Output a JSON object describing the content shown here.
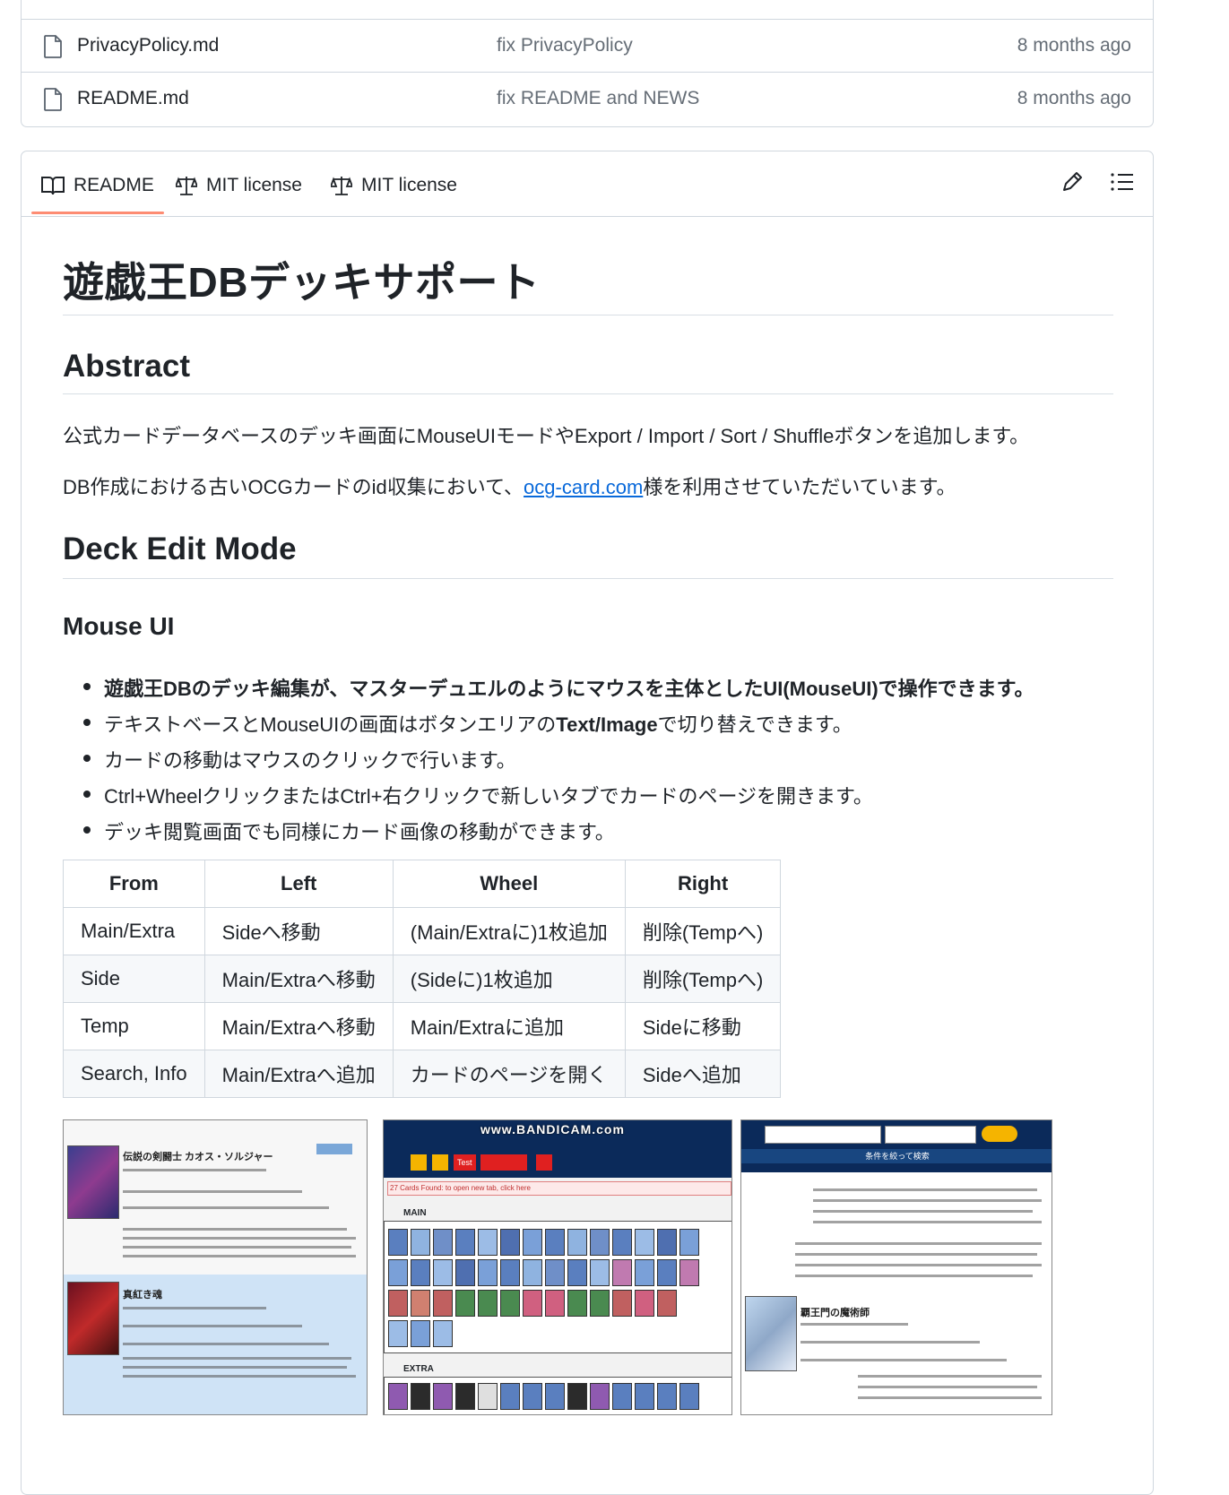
{
  "files": [
    {
      "name": "PrivacyPolicy.md",
      "message": "fix PrivacyPolicy",
      "age": "8 months ago"
    },
    {
      "name": "README.md",
      "message": "fix README and NEWS",
      "age": "8 months ago"
    }
  ],
  "tabs": [
    {
      "label": "README",
      "icon": "book-icon",
      "active": true
    },
    {
      "label": "MIT license",
      "icon": "scale-icon",
      "active": false
    },
    {
      "label": "MIT license",
      "icon": "scale-icon",
      "active": false
    }
  ],
  "toolbar": {
    "edit_icon": "pencil-icon",
    "outline_icon": "list-icon"
  },
  "readme": {
    "title": "遊戯王DBデッキサポート",
    "abstract_heading": "Abstract",
    "abstract_p1": "公式カードデータベースのデッキ画面にMouseUIモードやExport / Import / Sort / Shuffleボタンを追加します。",
    "abstract_p2_before": "DB作成における古いOCGカードのid収集において、",
    "abstract_p2_link": "ocg-card.com",
    "abstract_p2_after": "様を利用させていただいています。",
    "deck_edit_heading": "Deck Edit Mode",
    "mouse_ui_heading": "Mouse UI",
    "bullets": [
      {
        "bold": "遊戯王DBのデッキ編集が、マスターデュエルのようにマウスを主体としたUI(MouseUI)で操作できます。"
      },
      {
        "pre": "テキストベースとMouseUIの画面はボタンエリアの",
        "bold": "Text/Image",
        "post": "で切り替えできます。"
      },
      {
        "pre": "カードの移動はマウスのクリックで行います。"
      },
      {
        "pre": "Ctrl+WheelクリックまたはCtrl+右クリックで新しいタブでカードのページを開きます。"
      },
      {
        "pre": "デッキ閲覧画面でも同様にカード画像の移動ができます。"
      }
    ],
    "table": {
      "headers": [
        "From",
        "Left",
        "Wheel",
        "Right"
      ],
      "rows": [
        [
          "Main/Extra",
          "Sideへ移動",
          "(Main/Extraに)1枚追加",
          "削除(Tempへ)"
        ],
        [
          "Side",
          "Main/Extraへ移動",
          "(Sideに)1枚追加",
          "削除(Tempへ)"
        ],
        [
          "Temp",
          "Main/Extraへ移動",
          "Main/Extraに追加",
          "Sideに移動"
        ],
        [
          "Search, Info",
          "Main/Extraへ追加",
          "カードのページを開く",
          "Sideへ追加"
        ]
      ]
    },
    "screenshots": {
      "watermark": "www.BANDICAM.com",
      "middle_main": "MAIN",
      "middle_extra": "EXTRA",
      "middle_found": "27 Cards Found: to open new tab, click here",
      "left_card1": "伝説の剣闘士 カオス・ソルジャー",
      "left_card2": "真紅き魂",
      "right_search": "条件を絞って検索",
      "right_card": "覇王門の魔術師"
    }
  }
}
